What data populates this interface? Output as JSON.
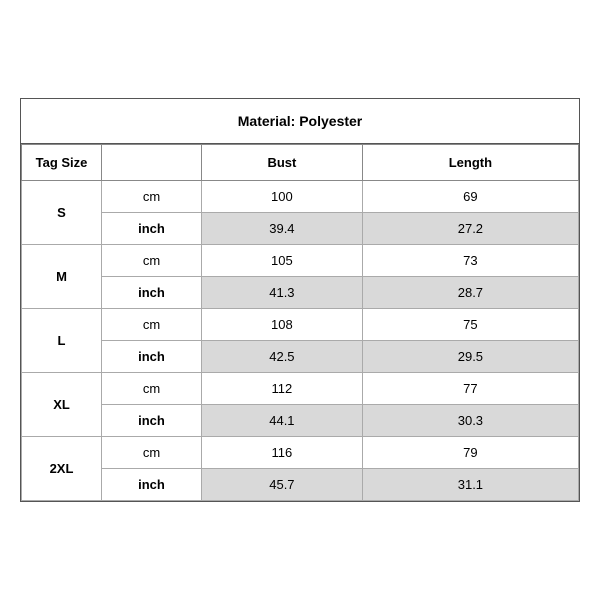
{
  "title": "Material: Polyester",
  "headers": {
    "tag_size": "Tag Size",
    "unit": "",
    "bust": "Bust",
    "length": "Length"
  },
  "sizes": [
    {
      "tag": "S",
      "cm": {
        "bust": "100",
        "length": "69"
      },
      "inch": {
        "bust": "39.4",
        "length": "27.2"
      }
    },
    {
      "tag": "M",
      "cm": {
        "bust": "105",
        "length": "73"
      },
      "inch": {
        "bust": "41.3",
        "length": "28.7"
      }
    },
    {
      "tag": "L",
      "cm": {
        "bust": "108",
        "length": "75"
      },
      "inch": {
        "bust": "42.5",
        "length": "29.5"
      }
    },
    {
      "tag": "XL",
      "cm": {
        "bust": "112",
        "length": "77"
      },
      "inch": {
        "bust": "44.1",
        "length": "30.3"
      }
    },
    {
      "tag": "2XL",
      "cm": {
        "bust": "116",
        "length": "79"
      },
      "inch": {
        "bust": "45.7",
        "length": "31.1"
      }
    }
  ],
  "unit_labels": {
    "cm": "cm",
    "inch": "inch"
  }
}
